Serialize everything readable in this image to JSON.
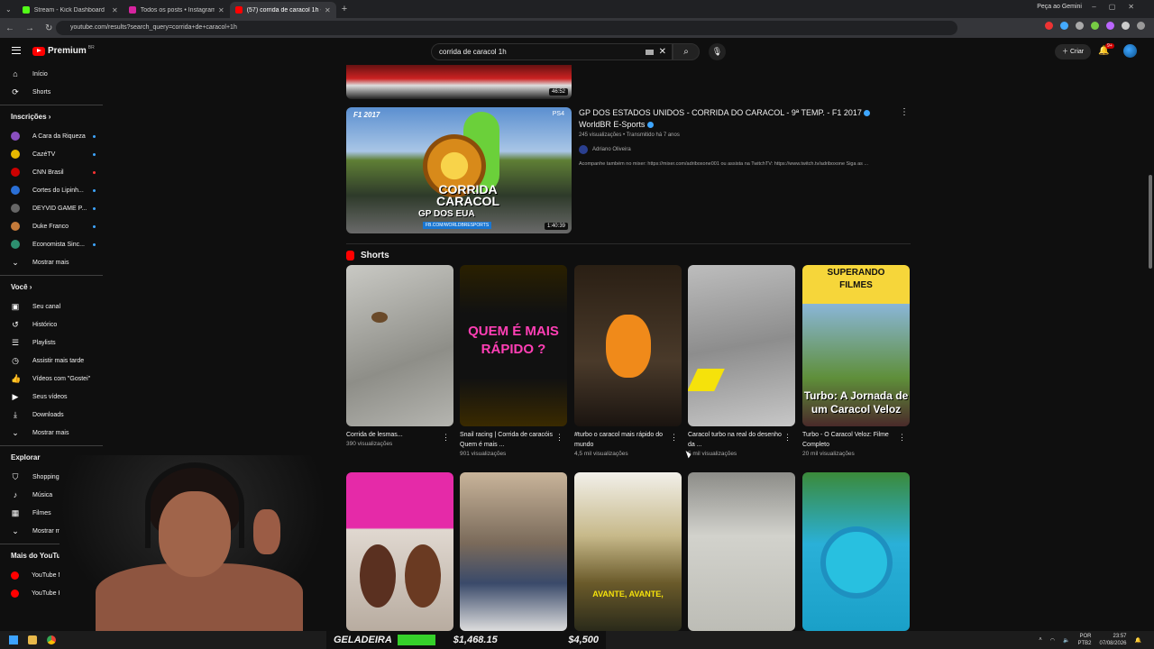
{
  "browser": {
    "tabs": [
      {
        "title": "Stream - Kick Dashboard",
        "color": "#53fc18",
        "active": false
      },
      {
        "title": "Todos os posts • Instagram",
        "color": "#d6249f",
        "active": false
      },
      {
        "title": "(57) corrida de caracol 1h - You…",
        "color": "#ff0000",
        "active": true
      }
    ],
    "gemini": "Peça ao Gemini",
    "url": "youtube.com/results?search_query=corrida+de+caracol+1h"
  },
  "youtube": {
    "logo": "Premium",
    "region": "BR",
    "search_value": "corrida de caracol 1h",
    "create_label": "Criar",
    "notif_count": "9+"
  },
  "sidebar": {
    "main": [
      {
        "label": "Início",
        "icon": "home-icon"
      },
      {
        "label": "Shorts",
        "icon": "shorts-icon"
      }
    ],
    "subs_title": "Inscrições",
    "subs": [
      {
        "label": "A Cara da Riqueza",
        "color": "#8a4fbf"
      },
      {
        "label": "CazéTV",
        "color": "#e6b800"
      },
      {
        "label": "CNN Brasil",
        "color": "#cc0000"
      },
      {
        "label": "Cortes do Lipinh...",
        "color": "#2a6fd6"
      },
      {
        "label": "DEYVID GAME P...",
        "color": "#666"
      },
      {
        "label": "Duke Franco",
        "color": "#c47a3a"
      },
      {
        "label": "Economista Sinc...",
        "color": "#2d8f6f"
      }
    ],
    "more": "Mostrar mais",
    "you_title": "Você",
    "you": [
      {
        "label": "Seu canal",
        "icon": "channel-icon"
      },
      {
        "label": "Histórico",
        "icon": "history-icon"
      },
      {
        "label": "Playlists",
        "icon": "playlist-icon"
      },
      {
        "label": "Assistir mais tarde",
        "icon": "clock-icon"
      },
      {
        "label": "Vídeos com \"Gostei\"",
        "icon": "like-icon"
      },
      {
        "label": "Seus vídeos",
        "icon": "video-icon"
      },
      {
        "label": "Downloads",
        "icon": "download-icon"
      }
    ],
    "explore_title": "Explorar",
    "explore": [
      {
        "label": "Shopping",
        "icon": "bag-icon"
      },
      {
        "label": "Música",
        "icon": "music-icon"
      },
      {
        "label": "Filmes",
        "icon": "film-icon"
      }
    ],
    "more_yt_title": "Mais do YouTube",
    "more_yt": [
      {
        "label": "YouTube Music"
      },
      {
        "label": "YouTube Kids"
      }
    ]
  },
  "results": {
    "top_duration": "46:52",
    "video": {
      "title": "GP DOS ESTADOS UNIDOS - CORRIDA DO CARACOL - 9ª TEMP. - F1 2017",
      "channel_tag": "WorldBR E-Sports",
      "views": "245 visualizações",
      "age": "Transmitido há 7 anos",
      "channel": "Adriano Oliveira",
      "desc": "Acompanhe também no mixer: https://mixer.com/adriboxone001 ou assista na TwitchTV: https://www.twitch.tv/adriboxone Siga as ...",
      "duration": "1:40:39",
      "thumb_f1": "F1 2017",
      "thumb_ps": "PS4",
      "thumb_title": "CORRIDA CARACOL",
      "thumb_sub": "GP DOS EUA",
      "thumb_tag": "FB.COM/WORLDBRESPORTS"
    },
    "shorts_title": "Shorts",
    "shorts": [
      {
        "title": "Corrida de lesmas...",
        "views": "390 visualizações",
        "overlay": ""
      },
      {
        "title": "Snail racing | Corrida de caracóis  Quem é mais ...",
        "views": "901 visualizações",
        "overlay": "QUEM É MAIS RÁPIDO ?"
      },
      {
        "title": "#turbo o caracol mais rápido do mundo",
        "views": "4,5 mil visualizações",
        "overlay": ""
      },
      {
        "title": "Caracol turbo na real do desenho da ...",
        "views": "5 mil visualizações",
        "overlay": ""
      },
      {
        "title": "Turbo - O Caracol Veloz: Filme Completo",
        "views": "20 mil visualizações",
        "overlay": "SUPERANDO FILMES",
        "overlay2": "Turbo: A Jornada de um Caracol Veloz"
      }
    ],
    "row2_overlay": "AVANTE, AVANTE,"
  },
  "stream_overlay": {
    "label": "GELADEIRA",
    "amount1": "$1,468.15",
    "amount2": "$4,500"
  },
  "taskbar": {
    "lang": "POR",
    "lang2": "PTB2",
    "time": "23:57",
    "date": "07/08/2026"
  }
}
